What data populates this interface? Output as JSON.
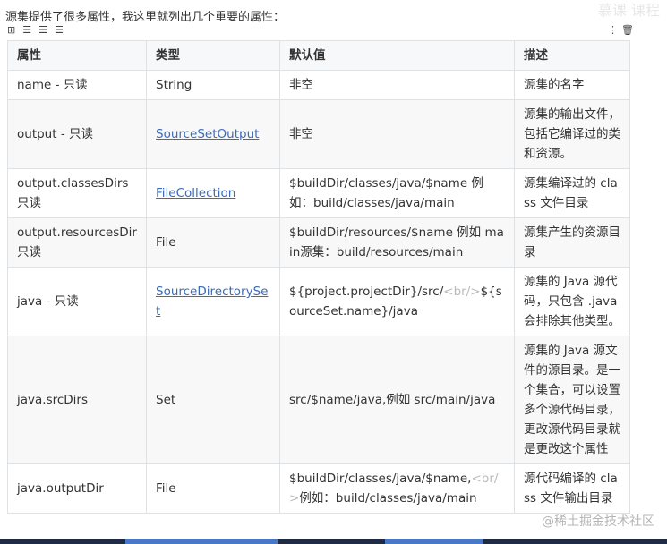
{
  "intro": "源集提供了很多属性，我这里就列出几个重要的属性：",
  "watermark_top": "慕课 课程",
  "toolbar": {
    "left_icons": [
      "grid-icon",
      "align-left-icon",
      "align-center-icon",
      "align-right-icon"
    ],
    "left_glyphs": [
      "⊞",
      "☰",
      "☰",
      "☰"
    ],
    "right_icons": [
      "more-vertical-icon",
      "trash-icon"
    ],
    "right_glyphs": [
      "⋮",
      "🗑"
    ]
  },
  "table": {
    "headers": [
      "属性",
      "类型",
      "默认值",
      "描述"
    ],
    "rows": [
      {
        "prop": "name - 只读",
        "type": "String",
        "type_link": false,
        "default": "非空",
        "desc": "源集的名字"
      },
      {
        "prop": "output - 只读",
        "type": "SourceSetOutput",
        "type_link": true,
        "default": "非空",
        "desc": "源集的输出文件，包括它编译过的类和资源。"
      },
      {
        "prop": "output.classesDirs 只读",
        "type": "FileCollection",
        "type_link": true,
        "default": "$buildDir/classes/java/$name 例如：build/classes/java/main",
        "desc": "源集编译过的 class 文件目录"
      },
      {
        "prop": "output.resourcesDir 只读",
        "type": "File",
        "type_link": false,
        "default": "$buildDir/resources/$name 例如 main源集：build/resources/main",
        "desc": "源集产生的资源目录"
      },
      {
        "prop": "java - 只读",
        "type": "SourceDirectorySet",
        "type_link": true,
        "default": "${project.projectDir}/src/",
        "default_tag": "<br/>",
        "default_tail": "${sourceSet.name}/java",
        "desc": "源集的 Java 源代码，只包含 .java 会排除其他类型。"
      },
      {
        "prop": "java.srcDirs",
        "type": "Set",
        "type_link": false,
        "default": "src/$name/java,例如 src/main/java",
        "desc": "源集的 Java 源文件的源目录。是一个集合，可以设置多个源代码目录，更改源代码目录就是更改这个属性"
      },
      {
        "prop": "java.outputDir",
        "type": "File",
        "type_link": false,
        "default": "$buildDir/classes/java/$name,",
        "default_tag": "<br/>",
        "default_tail": "例如：build/classes/java/main",
        "desc": "源代码编译的 class 文件输出目录"
      }
    ]
  },
  "watermark": "@稀土掘金技术社区",
  "colors": {
    "link": "#3c6bb8",
    "header_bg": "#f6f8fa",
    "border": "#dfe2e5"
  }
}
